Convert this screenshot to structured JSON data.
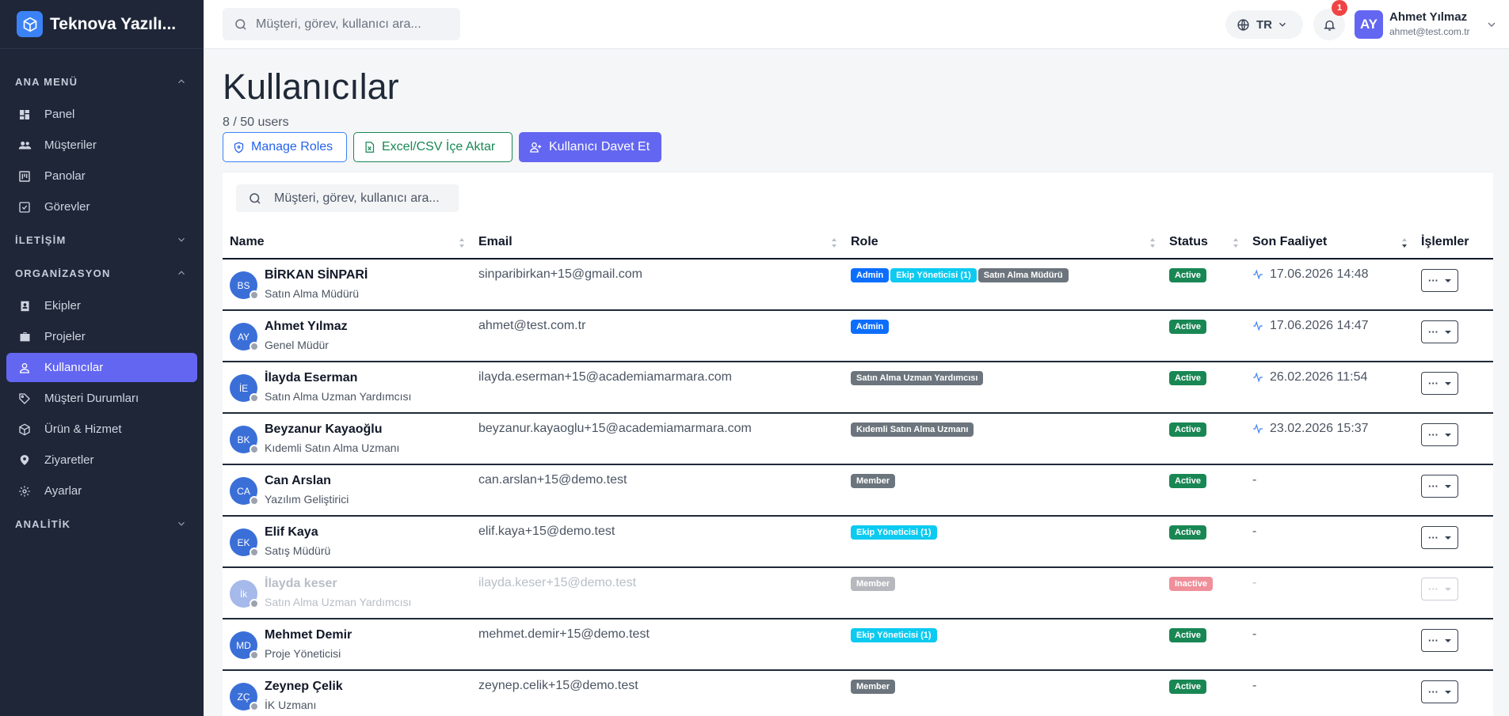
{
  "app": {
    "brand": "Teknova Yazılı..."
  },
  "sidebar": {
    "sections": [
      {
        "title": "ANA MENÜ",
        "items": [
          "Panel",
          "Müşteriler",
          "Panolar",
          "Görevler"
        ]
      },
      {
        "title": "İLETİŞİM",
        "items": []
      },
      {
        "title": "ORGANİZASYON",
        "items": [
          "Ekipler",
          "Projeler",
          "Kullanıcılar",
          "Müşteri Durumları",
          "Ürün & Hizmet",
          "Ziyaretler",
          "Ayarlar"
        ]
      },
      {
        "title": "ANALİTİK",
        "items": []
      }
    ],
    "active": "Kullanıcılar"
  },
  "topbar": {
    "search_placeholder": "Müşteri, görev, kullanıcı ara...",
    "language": "TR",
    "notification_count": "1",
    "user": {
      "initials": "AY",
      "name": "Ahmet Yılmaz",
      "email": "ahmet@test.com.tr"
    }
  },
  "page": {
    "title": "Kullanıcılar",
    "count": "8 / 50 users",
    "buttons": {
      "roles": "Manage Roles",
      "import": "Excel/CSV İçe Aktar",
      "invite": "Kullanıcı Davet Et"
    }
  },
  "table": {
    "search_placeholder": "Müşteri, görev, kullanıcı ara...",
    "headers": {
      "name": "Name",
      "email": "Email",
      "role": "Role",
      "status": "Status",
      "last_activity": "Son Faaliyet",
      "actions": "İşlemler"
    },
    "action_label": "···",
    "rows": [
      {
        "initials": "BS",
        "name": "BİRKAN SİNPARİ",
        "title": "Satın Alma Müdürü",
        "email": "sinparibirkan+15@gmail.com",
        "roles": [
          {
            "label": "Admin",
            "kind": "admin"
          },
          {
            "label": "Ekip Yöneticisi (1)",
            "kind": "lead"
          },
          {
            "label": "Satın Alma Müdürü",
            "kind": "gray"
          }
        ],
        "status": "Active",
        "last": "17.06.2026 14:48"
      },
      {
        "initials": "AY",
        "name": "Ahmet Yılmaz",
        "title": "Genel Müdür",
        "email": "ahmet@test.com.tr",
        "roles": [
          {
            "label": "Admin",
            "kind": "admin"
          }
        ],
        "status": "Active",
        "last": "17.06.2026 14:47"
      },
      {
        "initials": "İE",
        "name": "İlayda Eserman",
        "title": "Satın Alma Uzman Yardımcısı",
        "email": "ilayda.eserman+15@academiamarmara.com",
        "roles": [
          {
            "label": "Satın Alma Uzman Yardımcısı",
            "kind": "gray"
          }
        ],
        "status": "Active",
        "last": "26.02.2026 11:54"
      },
      {
        "initials": "BK",
        "name": "Beyzanur Kayaoğlu",
        "title": "Kıdemli Satın Alma Uzmanı",
        "email": "beyzanur.kayaoglu+15@academiamarmara.com",
        "roles": [
          {
            "label": "Kıdemli Satın Alma Uzmanı",
            "kind": "gray"
          }
        ],
        "status": "Active",
        "last": "23.02.2026 15:37"
      },
      {
        "initials": "CA",
        "name": "Can Arslan",
        "title": "Yazılım Geliştirici",
        "email": "can.arslan+15@demo.test",
        "roles": [
          {
            "label": "Member",
            "kind": "gray"
          }
        ],
        "status": "Active",
        "last": "-"
      },
      {
        "initials": "EK",
        "name": "Elif Kaya",
        "title": "Satış Müdürü",
        "email": "elif.kaya+15@demo.test",
        "roles": [
          {
            "label": "Ekip Yöneticisi (1)",
            "kind": "lead"
          }
        ],
        "status": "Active",
        "last": "-"
      },
      {
        "initials": "İk",
        "name": "İlayda keser",
        "title": "Satın Alma Uzman Yardımcısı",
        "email": "ilayda.keser+15@demo.test",
        "roles": [
          {
            "label": "Member",
            "kind": "gray"
          }
        ],
        "status": "Inactive",
        "last": "-"
      },
      {
        "initials": "MD",
        "name": "Mehmet Demir",
        "title": "Proje Yöneticisi",
        "email": "mehmet.demir+15@demo.test",
        "roles": [
          {
            "label": "Ekip Yöneticisi (1)",
            "kind": "lead"
          }
        ],
        "status": "Active",
        "last": "-"
      },
      {
        "initials": "ZÇ",
        "name": "Zeynep Çelik",
        "title": "İK Uzmanı",
        "email": "zeynep.celik+15@demo.test",
        "roles": [
          {
            "label": "Member",
            "kind": "gray"
          }
        ],
        "status": "Active",
        "last": "-"
      }
    ]
  }
}
